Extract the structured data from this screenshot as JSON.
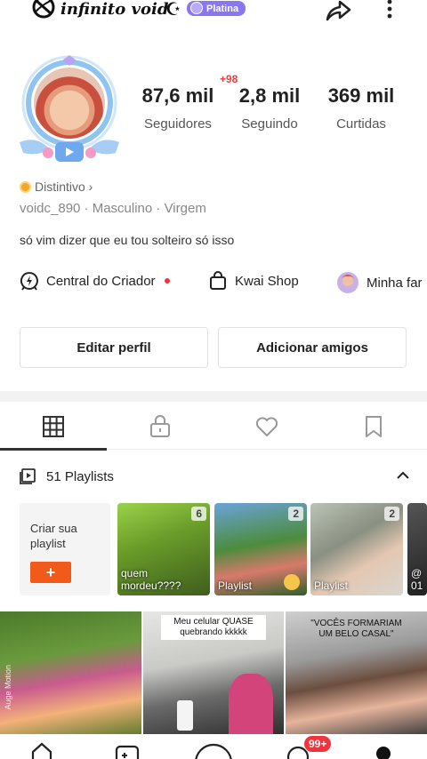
{
  "header": {
    "username_title": "infinito void",
    "moon_symbol": "☪",
    "tier_label": "Platina",
    "share_icon": "share-icon",
    "more_icon": "more-vertical-icon"
  },
  "profile": {
    "avatar_icon": "avatar",
    "new_followers_badge": "+98",
    "stats": [
      {
        "value": "87,6 mil",
        "label": "Seguidores"
      },
      {
        "value": "2,8 mil",
        "label": "Seguindo"
      },
      {
        "value": "369 mil",
        "label": "Curtidas"
      }
    ],
    "badge_link": "Distintivo ›",
    "meta": "voidc_890  ·  Masculino  ·  Virgem",
    "bio": "só vim dizer que eu tou solteiro só isso"
  },
  "shortcuts": [
    {
      "label": "Central do Criador",
      "icon": "creator-center-icon",
      "has_dot": true
    },
    {
      "label": "Kwai Shop",
      "icon": "shopping-bag-icon",
      "has_dot": false
    },
    {
      "label": "Minha far",
      "icon": "family-avatar-icon",
      "has_dot": false
    }
  ],
  "buttons": {
    "edit_profile": "Editar perfil",
    "add_friends": "Adicionar amigos"
  },
  "tabs": [
    {
      "name": "grid-icon",
      "active": true
    },
    {
      "name": "lock-icon",
      "active": false
    },
    {
      "name": "heart-icon",
      "active": false
    },
    {
      "name": "bookmark-icon",
      "active": false
    }
  ],
  "playlists": {
    "header": "51 Playlists",
    "create_label": "Criar sua playlist",
    "create_button": "+",
    "items": [
      {
        "count": "6",
        "title": "quem\nmordeu????"
      },
      {
        "count": "2",
        "title": "Playlist"
      },
      {
        "count": "2",
        "title": "Playlist"
      },
      {
        "count": "",
        "title": "@\n01"
      }
    ]
  },
  "videos": [
    {
      "caption": "",
      "watermark": "Auge Motion"
    },
    {
      "caption": "Meu celular QUASE quebrando kkkkk",
      "watermark": ""
    },
    {
      "caption": "\"VOCÊS FORMARIAM UM BELO CASAL\"",
      "watermark": ""
    }
  ],
  "bottom_nav": {
    "badge": "99+"
  },
  "colors": {
    "accent_orange": "#f25a1c",
    "tier_purple": "#8a76ee",
    "notification_red": "#f2333b"
  }
}
